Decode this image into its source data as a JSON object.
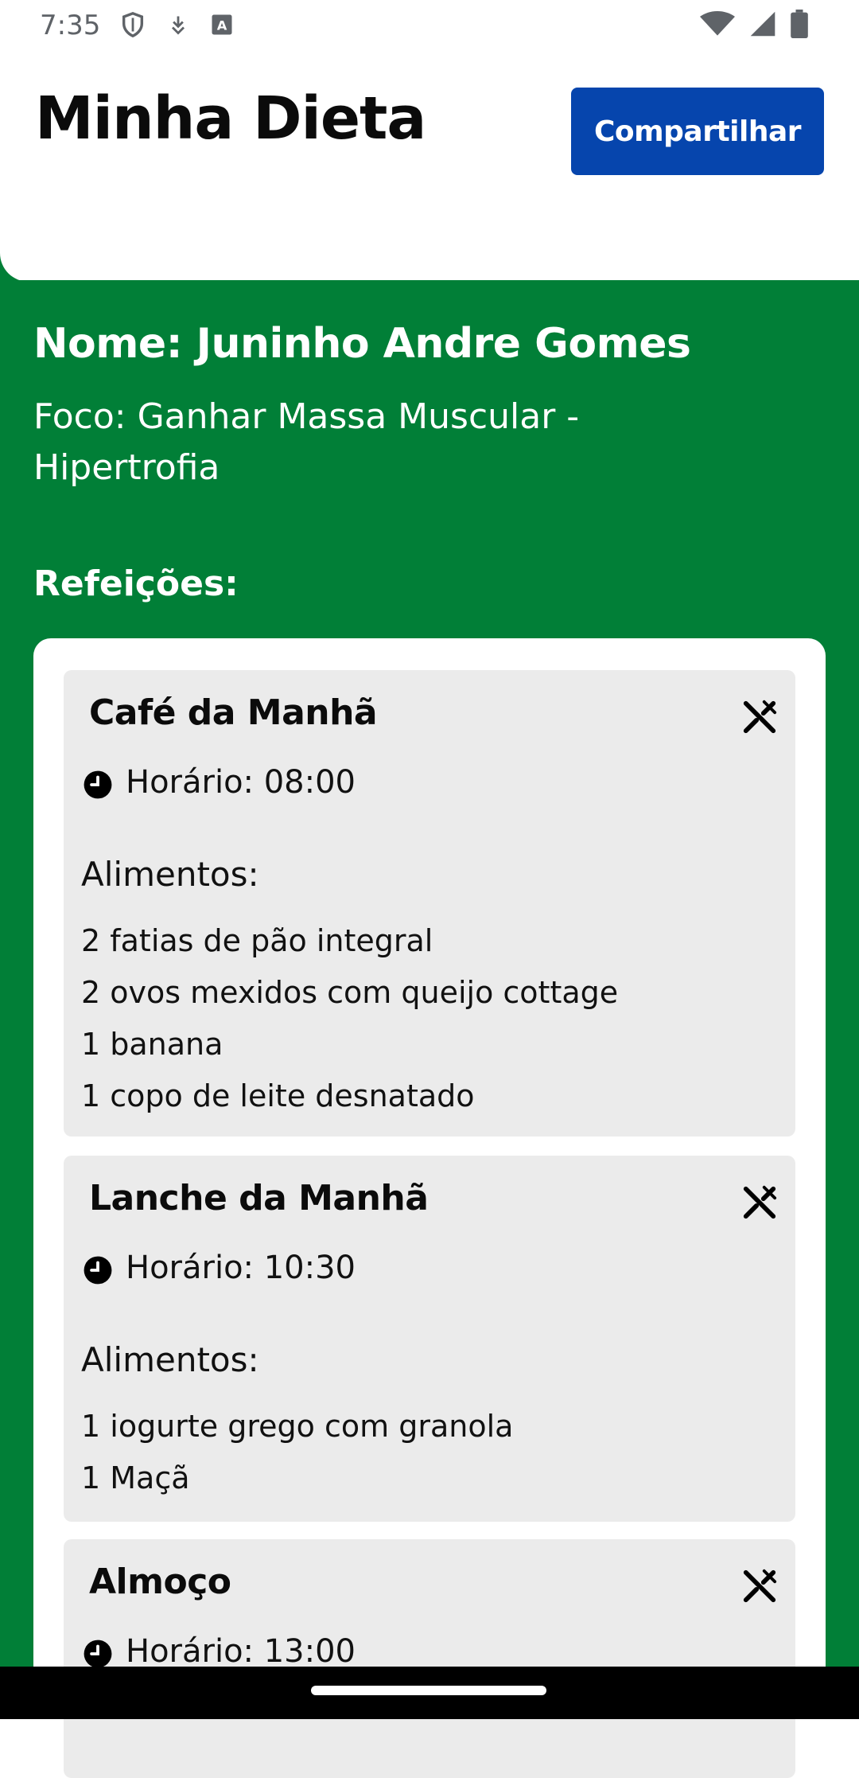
{
  "status_bar": {
    "time": "7:35",
    "left_icons": [
      "shield-icon",
      "download-icon",
      "text-a-icon"
    ],
    "right_icons": [
      "wifi-icon",
      "signal-icon",
      "battery-icon"
    ]
  },
  "header": {
    "title": "Minha Dieta",
    "share_label": "Compartilhar"
  },
  "profile": {
    "name": "Nome: Juninho Andre Gomes",
    "focus": "Foco: Ganhar Massa Muscular - Hipertrofia"
  },
  "meals_heading": "Refeições:",
  "meals": [
    {
      "title": "Café da Manhã",
      "time": "Horário: 08:00",
      "foods_label": "Alimentos:",
      "foods": [
        "2 fatias de pão integral",
        "2 ovos mexidos com queijo cottage",
        "1 banana",
        "1 copo de leite desnatado"
      ]
    },
    {
      "title": "Lanche da Manhã",
      "time": "Horário: 10:30",
      "foods_label": "Alimentos:",
      "foods": [
        "1 iogurte grego com granola",
        "1 Maçã"
      ]
    },
    {
      "title": "Almoço",
      "time": "Horário: 13:00",
      "foods_label": "",
      "foods": []
    }
  ],
  "colors": {
    "primary_green": "#017f37",
    "button_blue": "#0645ad",
    "card_gray": "#ebebeb"
  }
}
